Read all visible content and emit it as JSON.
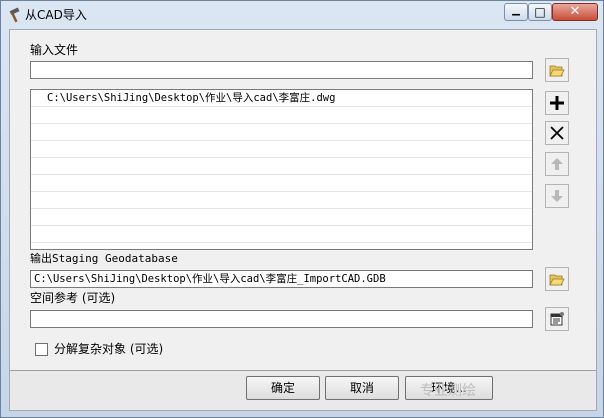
{
  "window": {
    "title": "从CAD导入"
  },
  "form": {
    "input_files_label": "输入文件",
    "input_files_value": "",
    "file_list": [
      "C:\\Users\\ShiJing\\Desktop\\作业\\导入cad\\李富庄.dwg"
    ],
    "output_label": "输出Staging Geodatabase",
    "output_value": "C:\\Users\\ShiJing\\Desktop\\作业\\导入cad\\李富庄_ImportCAD.GDB",
    "spatial_ref_label": "空间参考 (可选)",
    "spatial_ref_value": "",
    "explode_label": "分解复杂对象 (可选)",
    "explode_checked": false
  },
  "buttons": {
    "ok": "确定",
    "cancel": "取消",
    "env": "环境..."
  },
  "watermark": "专业测绘"
}
